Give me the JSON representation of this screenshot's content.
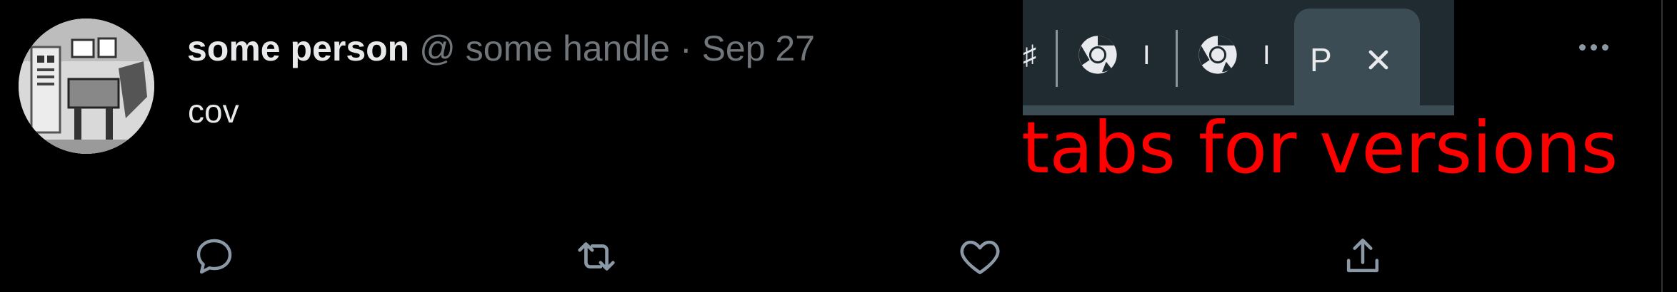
{
  "tweet": {
    "author_name": "some person",
    "handle_prefix": "@",
    "handle": "some handle",
    "separator": "·",
    "timestamp": "Sep 27",
    "text": "cov",
    "actions": [
      "reply-icon",
      "retweet-icon",
      "like-icon",
      "share-icon"
    ],
    "more_icon": "more-horizontal-icon"
  },
  "pasted_screenshot": {
    "tabs": [
      {
        "icon": "chrome-icon",
        "title_fragment": "I"
      },
      {
        "icon": "chrome-icon",
        "title_fragment": "I"
      }
    ],
    "active_tab": {
      "title_fragment": "P",
      "close_icon": "close-icon"
    },
    "left_cut_fragment": "♯"
  },
  "annotation": {
    "text": "tabs for versions",
    "color": "#ff0000"
  },
  "colors": {
    "background": "#000000",
    "primary_text": "#e7e9ea",
    "secondary_text": "#71767b",
    "tabstrip_bg": "#202a31",
    "active_tab_bg": "#3c4c55"
  }
}
